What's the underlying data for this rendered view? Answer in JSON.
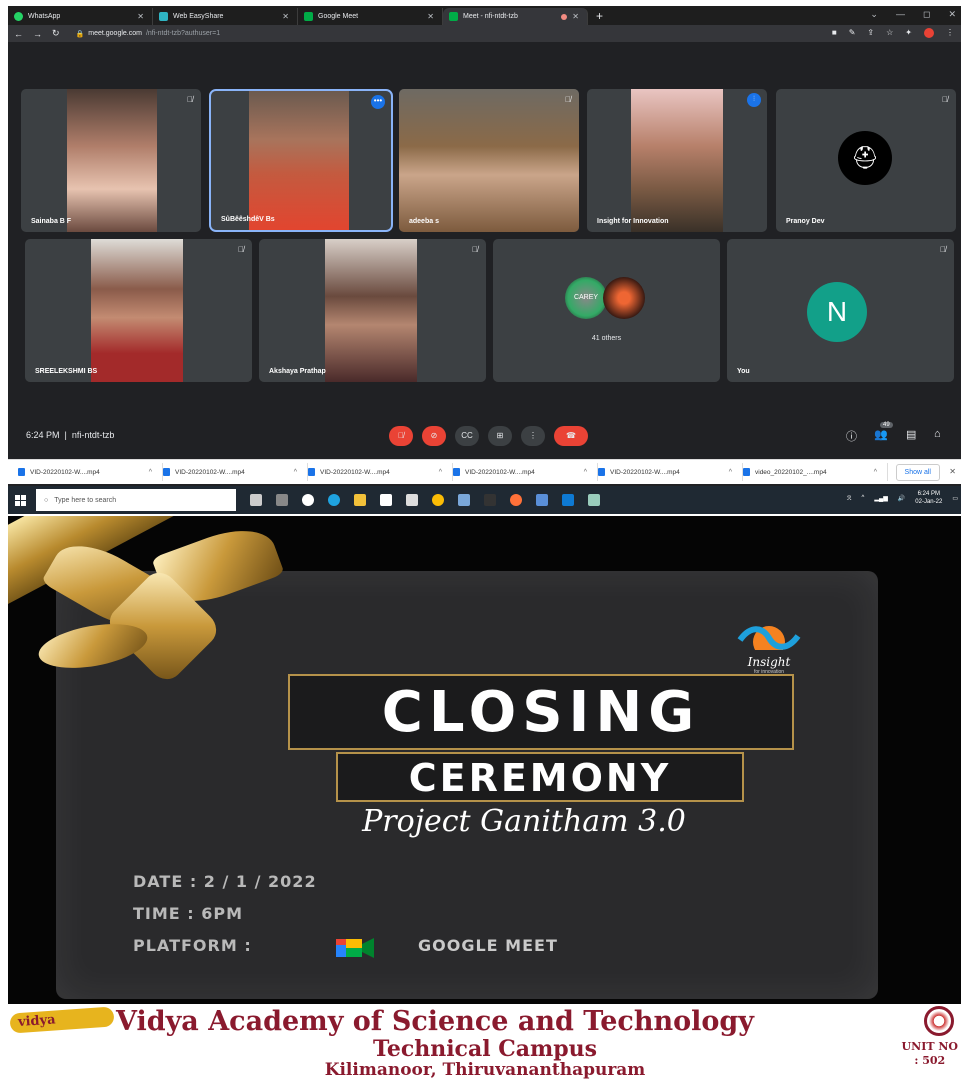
{
  "browser": {
    "tabs": [
      {
        "label": "WhatsApp",
        "favicon_color": "#25d366"
      },
      {
        "label": "Web EasyShare",
        "favicon_color": "#2fb4c2"
      },
      {
        "label": "Google Meet",
        "favicon_color": "#00ac47"
      },
      {
        "label": "Meet - nfi-ntdt-tzb",
        "favicon_color": "#00ac47",
        "active": true
      }
    ],
    "url_host": "meet.google.com",
    "url_path": "/nfi-ntdt-tzb?authuser=1"
  },
  "participants": [
    {
      "name": "Sainaba B F",
      "muted": true
    },
    {
      "name": "SûBêêshdêV Bs",
      "muted": false,
      "active": true
    },
    {
      "name": "adeeba s",
      "muted": true
    },
    {
      "name": "Insight for Innovation",
      "muted": false,
      "speaking": true
    },
    {
      "name": "Pranoy Dev",
      "muted": true
    },
    {
      "name": "SREELEKSHMI BS",
      "muted": true
    },
    {
      "name": "Akshaya Prathap",
      "muted": true
    },
    {
      "name": "41 others",
      "muted": false
    },
    {
      "name": "You",
      "muted": true,
      "avatar_letter": "N",
      "avatar_color": "#12a089"
    }
  ],
  "meeting": {
    "time": "6:24 PM",
    "code": "nfi-ntdt-tzb",
    "people_count": "49"
  },
  "downloads": [
    "VID-20220102-W....mp4",
    "VID-20220102-W....mp4",
    "VID-20220102-W....mp4",
    "VID-20220102-W....mp4",
    "VID-20220102-W....mp4",
    "video_20220102_....mp4"
  ],
  "downloads_show_all": "Show all",
  "taskbar": {
    "search_placeholder": "Type here to search",
    "clock_time": "6:24 PM",
    "clock_date": "02-Jan-22"
  },
  "poster": {
    "title1": "CLOSING",
    "title2": "CEREMONY",
    "project": "Project Ganitham 3.0",
    "date_line": "DATE : 2 / 1 / 2022",
    "time_line": "TIME  : 6PM",
    "platform_label": "PLATFORM :",
    "platform_value": "GOOGLE MEET",
    "logo_text": "Insight",
    "logo_sub": "for innovation",
    "college": "Vidya Academy of Science and Technology",
    "campus": "Technical Campus",
    "location": "Kilimanoor, Thiruvananthapuram",
    "unit_line1": "UNIT NO",
    "unit_line2": ": 502",
    "vidya_badge": "vidya"
  }
}
